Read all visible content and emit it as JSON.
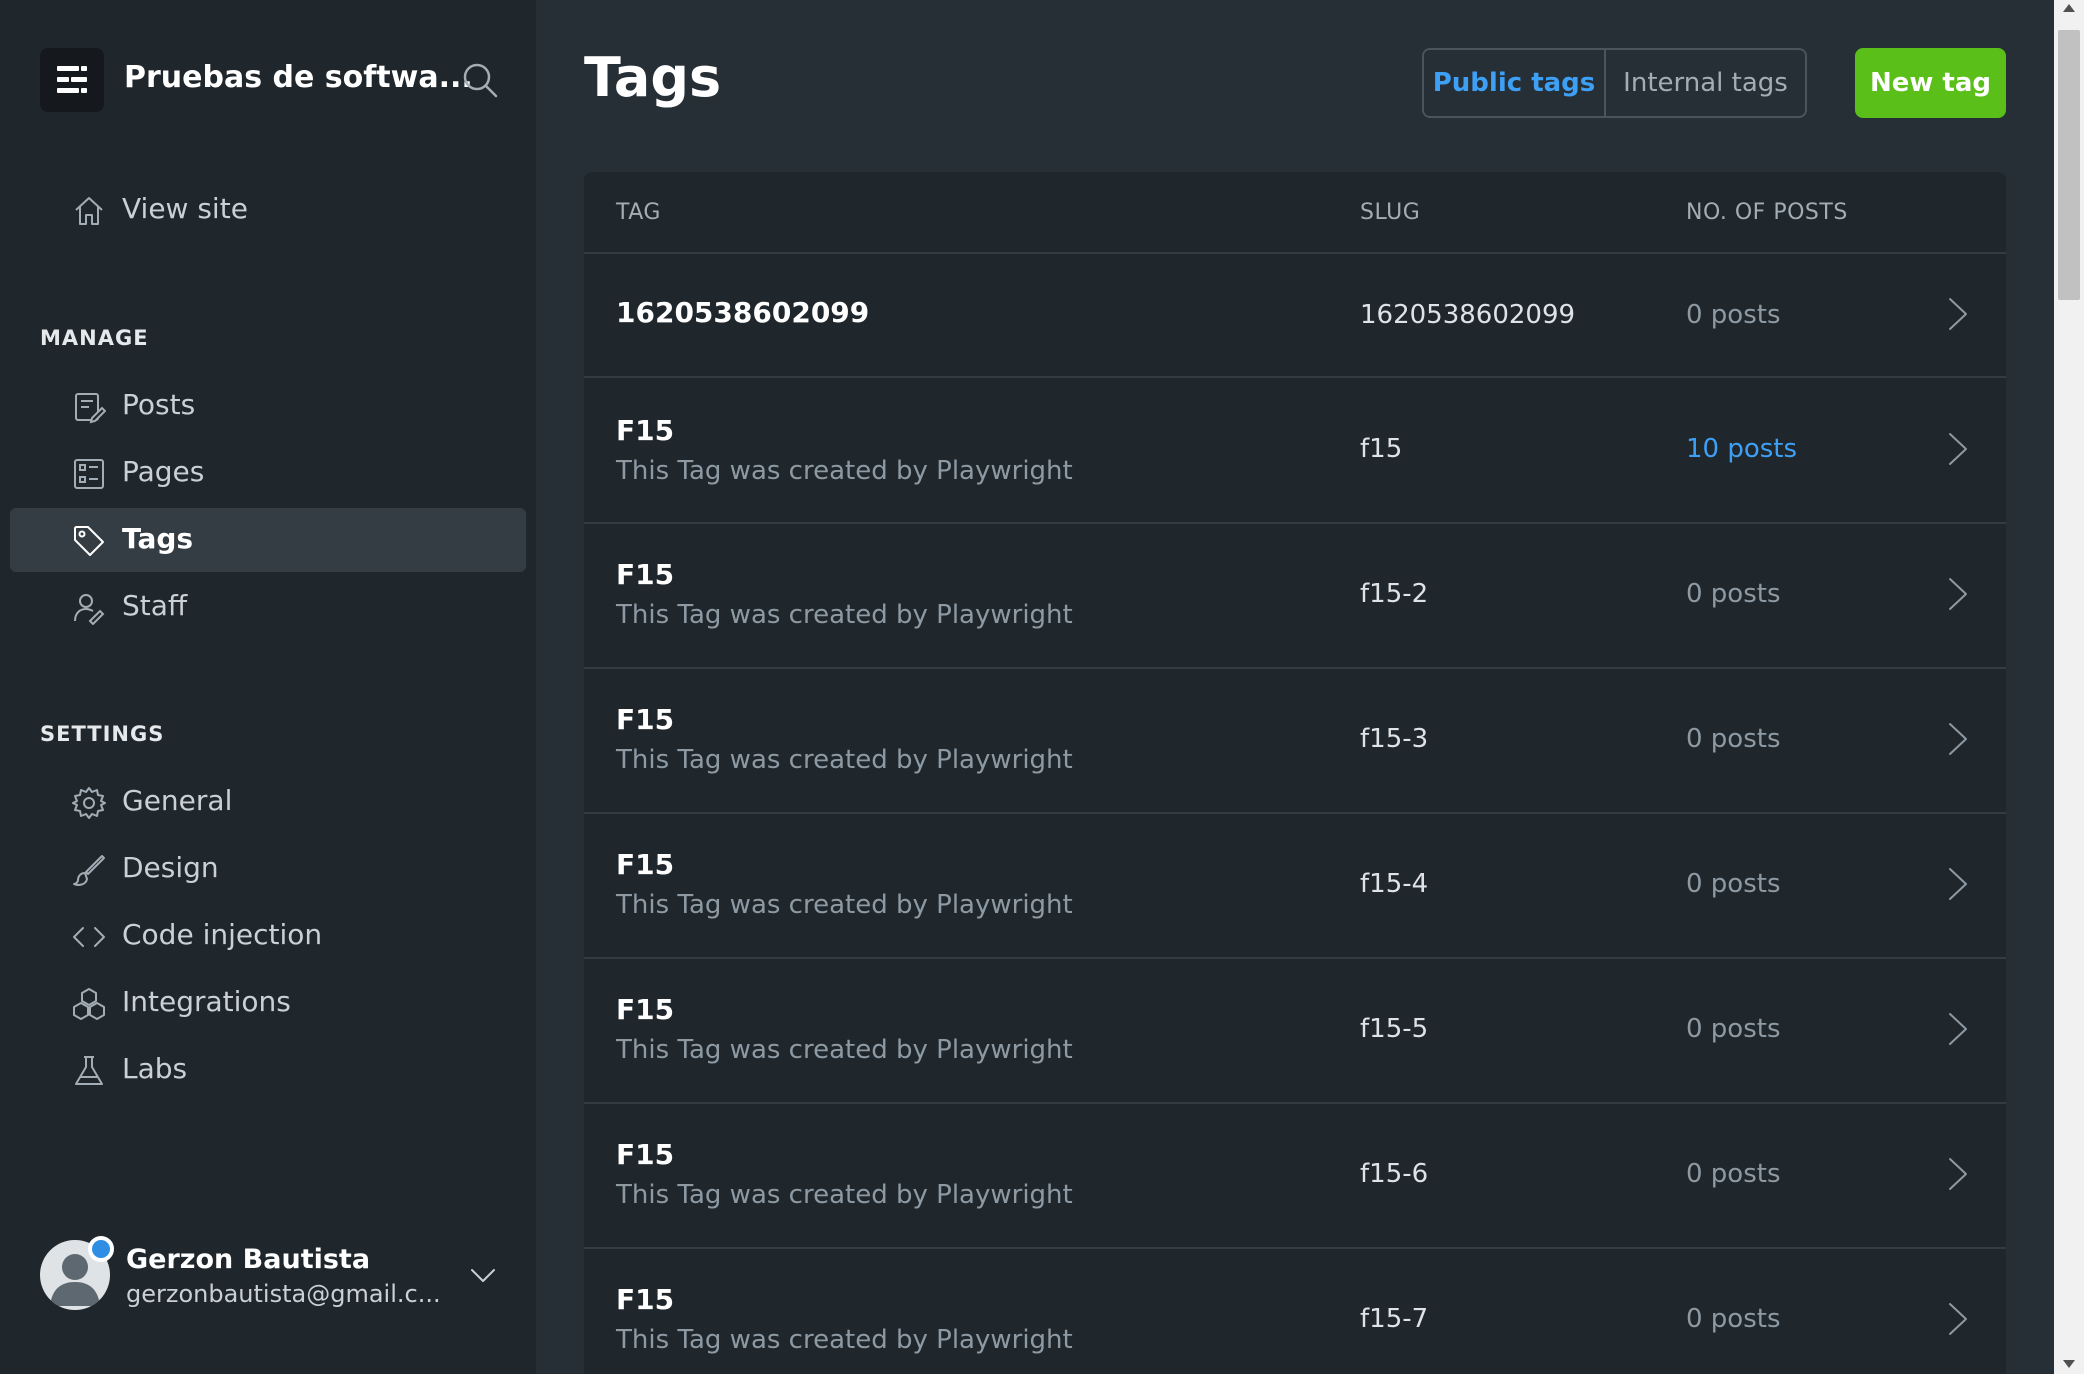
{
  "sidebar": {
    "site_title": "Pruebas de softwa...",
    "view_site": "View site",
    "manage_label": "MANAGE",
    "manage_items": [
      {
        "label": "Posts",
        "icon": "posts-icon"
      },
      {
        "label": "Pages",
        "icon": "pages-icon"
      },
      {
        "label": "Tags",
        "icon": "tag-icon",
        "active": true
      },
      {
        "label": "Staff",
        "icon": "staff-icon"
      }
    ],
    "settings_label": "SETTINGS",
    "settings_items": [
      {
        "label": "General",
        "icon": "gear-icon"
      },
      {
        "label": "Design",
        "icon": "brush-icon"
      },
      {
        "label": "Code injection",
        "icon": "code-icon"
      },
      {
        "label": "Integrations",
        "icon": "integrations-icon"
      },
      {
        "label": "Labs",
        "icon": "flask-icon"
      }
    ],
    "user": {
      "name": "Gerzon Bautista",
      "email": "gerzonbautista@gmail.c..."
    }
  },
  "header": {
    "title": "Tags",
    "public_tab": "Public tags",
    "internal_tab": "Internal tags",
    "new_tag": "New tag"
  },
  "table": {
    "columns": [
      "TAG",
      "SLUG",
      "NO. OF POSTS"
    ],
    "rows": [
      {
        "name": "1620538602099",
        "description": "",
        "slug": "1620538602099",
        "posts": "0 posts"
      },
      {
        "name": "F15",
        "description": "This Tag was created by Playwright",
        "slug": "f15",
        "posts": "10 posts"
      },
      {
        "name": "F15",
        "description": "This Tag was created by Playwright",
        "slug": "f15-2",
        "posts": "0 posts"
      },
      {
        "name": "F15",
        "description": "This Tag was created by Playwright",
        "slug": "f15-3",
        "posts": "0 posts"
      },
      {
        "name": "F15",
        "description": "This Tag was created by Playwright",
        "slug": "f15-4",
        "posts": "0 posts"
      },
      {
        "name": "F15",
        "description": "This Tag was created by Playwright",
        "slug": "f15-5",
        "posts": "0 posts"
      },
      {
        "name": "F15",
        "description": "This Tag was created by Playwright",
        "slug": "f15-6",
        "posts": "0 posts"
      },
      {
        "name": "F15",
        "description": "This Tag was created by Playwright",
        "slug": "f15-7",
        "posts": "0 posts"
      }
    ]
  },
  "colors": {
    "accent": "#3ea0f5",
    "new_tag_button": "#5bbf1a",
    "sidebar_bg": "#1f262c",
    "main_bg": "#262f36"
  }
}
